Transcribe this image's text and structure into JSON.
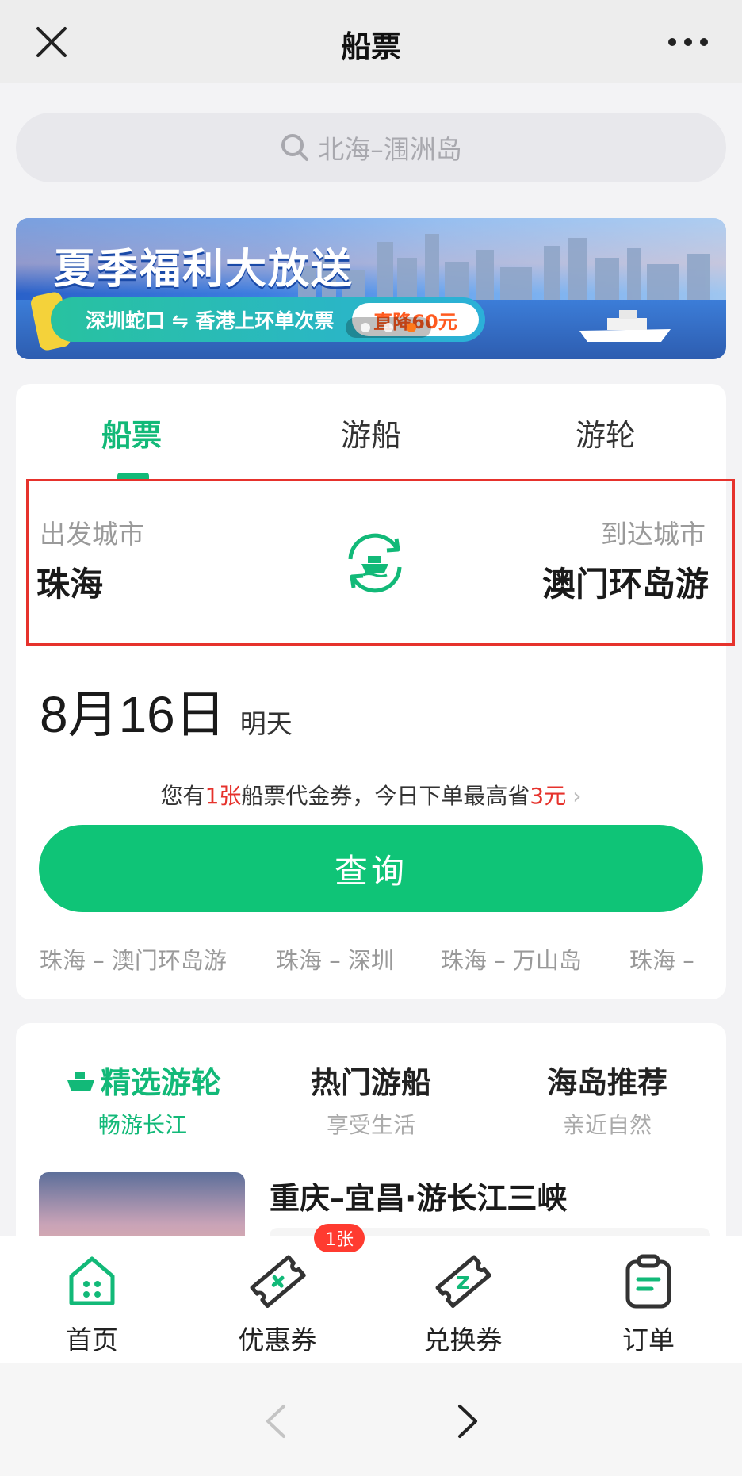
{
  "header": {
    "title": "船票",
    "close_icon": "close-icon",
    "more_icon": "more-icon"
  },
  "search": {
    "placeholder": "北海–涠洲岛"
  },
  "banner": {
    "headline": "夏季福利大放送",
    "route": "深圳蛇口 ⇋ 香港上环单次票",
    "deal": "直降60元"
  },
  "tabs": [
    {
      "label": "船票",
      "active": true
    },
    {
      "label": "游船",
      "active": false
    },
    {
      "label": "游轮",
      "active": false
    }
  ],
  "route": {
    "from_label": "出发城市",
    "from_city": "珠海",
    "to_label": "到达城市",
    "to_city": "澳门环岛游"
  },
  "date": {
    "value": "8月16日",
    "weekday": "明天"
  },
  "coupon": {
    "prefix": "您有",
    "count": "1张",
    "middle": "船票代金券，今日下单最高省",
    "amount": "3元",
    "chevron": "›"
  },
  "query_button": "查询",
  "history": [
    "珠海 – 澳门环岛游",
    "珠海 – 深圳",
    "珠海 – 万山岛",
    "珠海 –"
  ],
  "categories": [
    {
      "title": "精选游轮",
      "subtitle": "畅游长江",
      "active": true
    },
    {
      "title": "热门游船",
      "subtitle": "享受生活",
      "active": false
    },
    {
      "title": "海岛推荐",
      "subtitle": "亲近自然",
      "active": false
    }
  ],
  "featured": {
    "title": "重庆–宜昌·游长江三峡"
  },
  "bottom_nav": [
    {
      "label": "首页",
      "icon": "home-icon"
    },
    {
      "label": "优惠券",
      "icon": "coupon-icon",
      "badge": "1张"
    },
    {
      "label": "兑换券",
      "icon": "exchange-ticket-icon"
    },
    {
      "label": "订单",
      "icon": "order-icon"
    }
  ],
  "colors": {
    "brand_green": "#0fc477",
    "accent_red": "#e6322c"
  }
}
